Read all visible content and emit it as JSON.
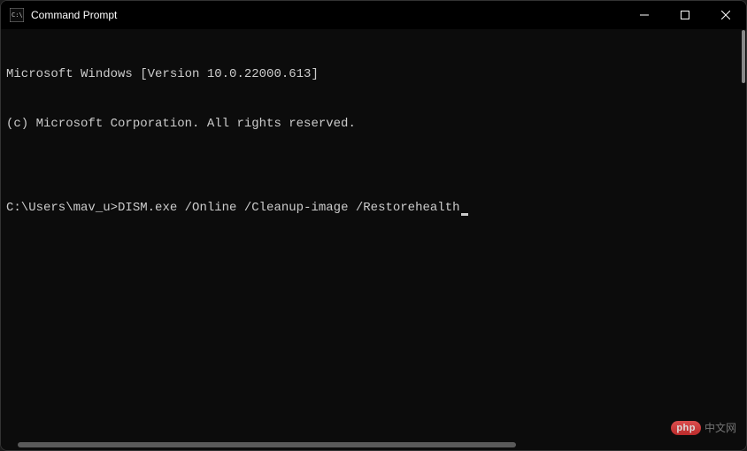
{
  "titlebar": {
    "title": "Command Prompt"
  },
  "terminal": {
    "line1": "Microsoft Windows [Version 10.0.22000.613]",
    "line2": "(c) Microsoft Corporation. All rights reserved.",
    "blank": "",
    "prompt": "C:\\Users\\mav_u>",
    "command": "DISM.exe /Online /Cleanup-image /Restorehealth"
  },
  "watermark": {
    "badge": "php",
    "text": "中文网"
  }
}
